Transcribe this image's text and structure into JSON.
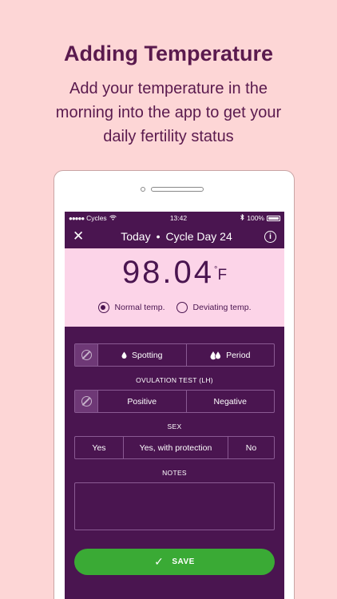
{
  "promo": {
    "title": "Adding Temperature",
    "subtitle": "Add your temperature in the morning into the app to get your daily fertility status"
  },
  "status_bar": {
    "carrier": "Cycles",
    "time": "13:42",
    "battery": "100%"
  },
  "nav": {
    "day_label": "Today",
    "separator": "•",
    "cycle_label": "Cycle Day 24"
  },
  "temperature": {
    "value": "98.04",
    "unit": "F",
    "degree": "°"
  },
  "temp_options": {
    "normal": "Normal temp.",
    "deviating": "Deviating temp.",
    "selected": "normal"
  },
  "bleeding": {
    "spotting": "Spotting",
    "period": "Period"
  },
  "ovulation": {
    "label": "OVULATION TEST (LH)",
    "positive": "Positive",
    "negative": "Negative"
  },
  "sex": {
    "label": "SEX",
    "yes": "Yes",
    "yes_protection": "Yes, with protection",
    "no": "No"
  },
  "notes": {
    "label": "NOTES"
  },
  "save": {
    "label": "SAVE"
  },
  "colors": {
    "background": "#fdd6d6",
    "brand_purple": "#4a1550",
    "temp_panel": "#fcd4e8",
    "save_green": "#3aaa35"
  }
}
